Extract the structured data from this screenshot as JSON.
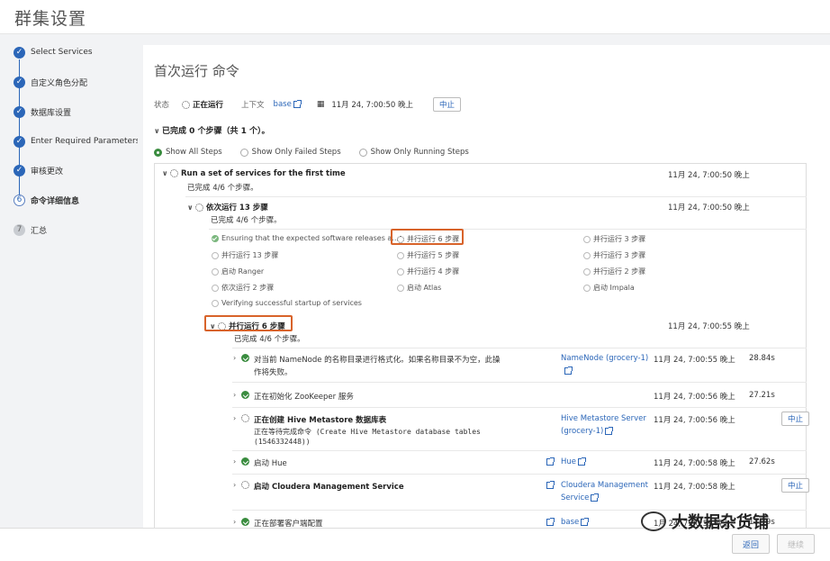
{
  "app_title": "群集设置",
  "sidebar": {
    "items": [
      {
        "label": "Select Services",
        "state": "done"
      },
      {
        "label": "自定义角色分配",
        "state": "done"
      },
      {
        "label": "数据库设置",
        "state": "done"
      },
      {
        "label": "Enter Required Parameters",
        "state": "done"
      },
      {
        "label": "审核更改",
        "state": "done"
      },
      {
        "label": "命令详细信息",
        "state": "current",
        "num": "6"
      },
      {
        "label": "汇总",
        "state": "todo",
        "num": "7"
      }
    ]
  },
  "page": {
    "title": "首次运行 命令",
    "status_label": "状态",
    "status_value": "正在运行",
    "context_label": "上下文",
    "context_value": "base",
    "datetime": "11月 24, 7:00:50 晚上",
    "abort_label": "中止",
    "summary": "已完成 0 个步骤（共 1 个）。"
  },
  "filters": [
    "Show All Steps",
    "Show Only Failed Steps",
    "Show Only Running Steps"
  ],
  "root": {
    "title": "Run a set of services for the first time",
    "sub": "已完成  4/6  个步骤。",
    "time": "11月 24, 7:00:50 晚上"
  },
  "seq": {
    "title": "依次运行 13 步骤",
    "sub": "已完成  4/6  个步骤。",
    "time": "11月 24, 7:00:50 晚上"
  },
  "grid": {
    "col1": [
      "Ensuring that the expected software releases a...",
      "并行运行 13 步骤",
      "启动 Ranger",
      "依次运行 2 步骤",
      "Verifying successful startup of services"
    ],
    "col2": [
      "并行运行 6 步骤",
      "并行运行 5 步骤",
      "并行运行 4 步骤",
      "启动 Atlas"
    ],
    "col3": [
      "并行运行 3 步骤",
      "并行运行 3 步骤",
      "并行运行 2 步骤",
      "启动 Impala"
    ]
  },
  "par": {
    "title": "并行运行 6 步骤",
    "sub": "已完成  4/6  个步骤。",
    "time": "11月 24, 7:00:55 晚上"
  },
  "tasks": [
    {
      "title": "对当前 NameNode 的名称目录进行格式化。如果名称目录不为空，此操",
      "title2": "作将失败。",
      "role": "NameNode (grocery-1)",
      "time": "11月 24, 7:00:55 晚上",
      "dur": "28.84s"
    },
    {
      "title": "正在初始化 ZooKeeper 服务",
      "time": "11月 24, 7:00:56 晚上",
      "dur": "27.21s"
    },
    {
      "title": "正在创建 Hive Metastore 数据库表",
      "sub": "正在等待完成命令 (Create Hive Metastore database tables",
      "sub2": "(1546332448))",
      "role": "Hive Metastore Server",
      "role2": "(grocery-1)",
      "time": "11月 24, 7:00:56 晚上",
      "abort": "中止"
    },
    {
      "title": "启动 Hue",
      "role": "Hue",
      "time": "11月 24, 7:00:58 晚上",
      "dur": "27.62s"
    },
    {
      "title": "启动 Cloudera Management Service",
      "role": "Cloudera Management",
      "role2": "Service",
      "time": "11月 24, 7:00:58 晚上",
      "abort": "中止"
    },
    {
      "title": "正在部署客户端配置",
      "role": "base",
      "time": "1月 24, 7:00:59 晚上",
      "dur": "17.79s"
    }
  ],
  "footer": {
    "back": "返回",
    "next": "继续"
  },
  "watermark": "大数据杂货铺"
}
